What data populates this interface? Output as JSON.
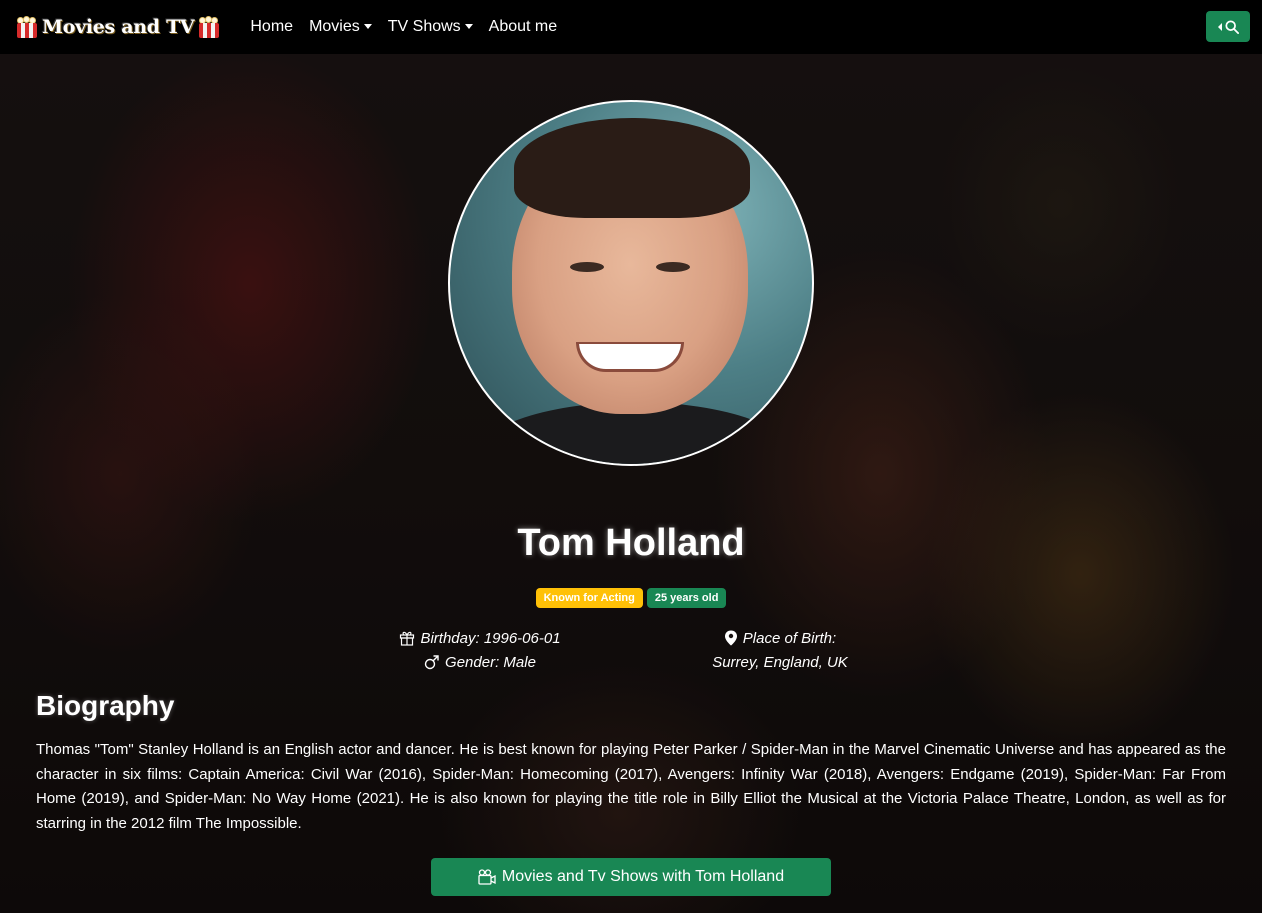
{
  "navbar": {
    "brand": "Movies and TV",
    "links": [
      {
        "label": "Home"
      },
      {
        "label": "Movies",
        "dropdown": true
      },
      {
        "label": "TV Shows",
        "dropdown": true
      },
      {
        "label": "About me"
      }
    ],
    "search_icon": "search-icon"
  },
  "person": {
    "name": "Tom Holland",
    "badges": {
      "known_for": "Known for Acting",
      "age": "25 years old"
    },
    "birthday": "Birthday: 1996-06-01",
    "gender": "Gender: Male",
    "place_of_birth_label": "Place of Birth:",
    "place_of_birth": "Surrey, England, UK"
  },
  "biography": {
    "title": "Biography",
    "text": "Thomas \"Tom\" Stanley Holland is an English actor and dancer. He is best known for playing Peter Parker / Spider-Man in the Marvel Cinematic Universe and has appeared as the character in six films: Captain America: Civil War (2016), Spider-Man: Homecoming (2017), Avengers: Infinity War (2018), Avengers: Endgame (2019), Spider-Man: Far From Home (2019), and Spider-Man: No Way Home (2021). He is also known for playing the title role in Billy Elliot the Musical at the Victoria Palace Theatre, London, as well as for starring in the 2012 film The Impossible."
  },
  "actions": {
    "movies_button": "Movies and Tv Shows with Tom Holland"
  },
  "colors": {
    "navbar": "#000000",
    "accent_green": "#198754",
    "badge_yellow": "#ffc107"
  }
}
